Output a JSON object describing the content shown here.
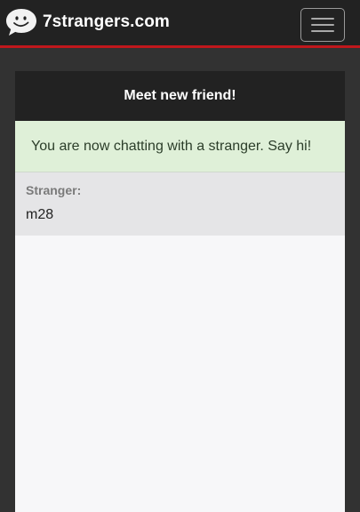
{
  "navbar": {
    "brand": "7strangers.com",
    "logo_icon": "speech-bubble-face-icon",
    "menu_icon": "hamburger-menu-icon",
    "accent_color": "#c0171c"
  },
  "chat": {
    "header": "Meet new friend!",
    "status": "You are now chatting with a stranger. Say hi!",
    "messages": [
      {
        "sender": "Stranger:",
        "text": "m28"
      }
    ]
  }
}
